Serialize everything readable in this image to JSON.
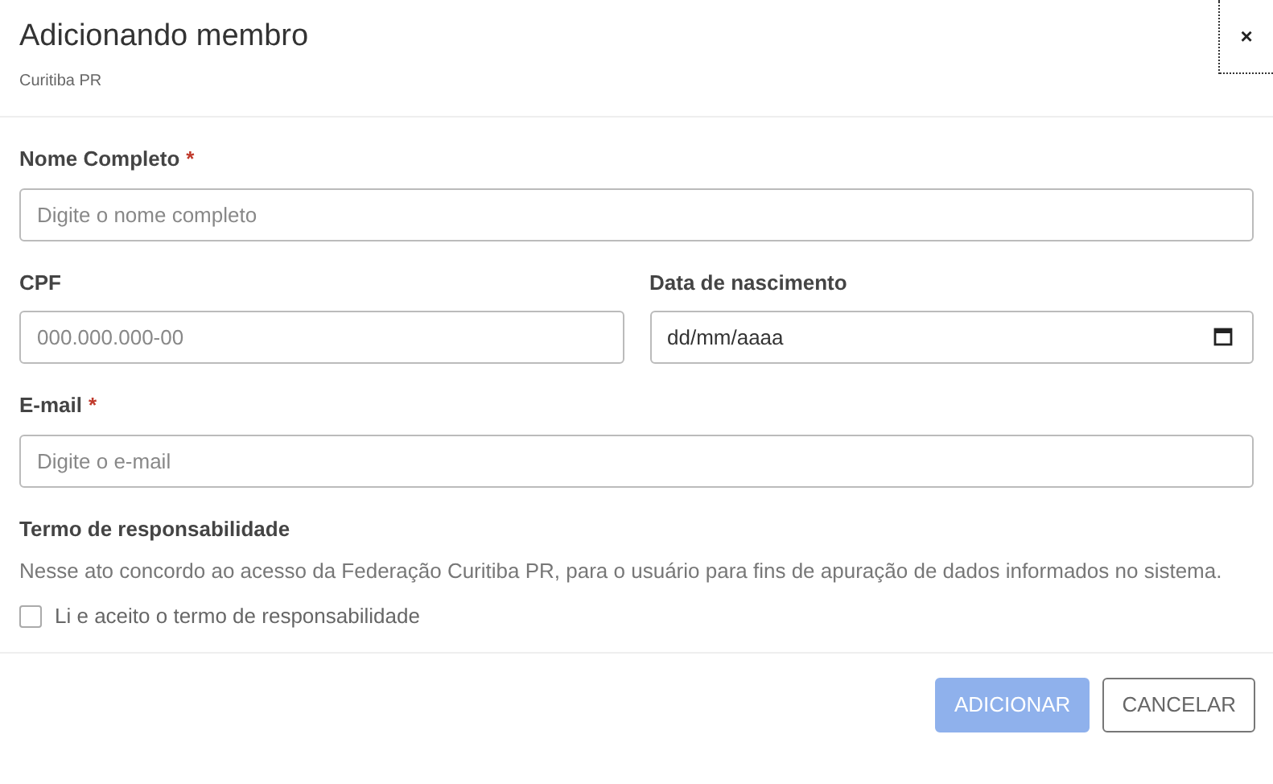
{
  "dialog": {
    "title": "Adicionando membro",
    "subtitle": "Curitiba PR",
    "close": "×"
  },
  "fields": [
    {
      "label": "Nome Completo",
      "required_mark": "*",
      "placeholder": "Digite o nome completo",
      "kind": "text"
    },
    {
      "label": "CPF",
      "placeholder": "000.000.000-00",
      "kind": "text"
    },
    {
      "label": "Data de nascimento",
      "placeholder": "dd/mm/aaaa",
      "kind": "date"
    },
    {
      "label": "E-mail",
      "required_mark": "*",
      "placeholder": "Digite o e-mail",
      "kind": "text"
    }
  ],
  "terms": {
    "title": "Termo de responsabilidade",
    "text": "Nesse ato concordo ao acesso da Federação Curitiba PR, para o usuário para fins de apuração de dados informados no sistema.",
    "checkbox_label": "Li e aceito o termo de responsabilidade",
    "checked": false
  },
  "buttons": [
    {
      "label": "ADICIONAR",
      "kind": "primary",
      "disabled": true
    },
    {
      "label": "CANCELAR",
      "kind": "secondary",
      "disabled": false
    }
  ]
}
